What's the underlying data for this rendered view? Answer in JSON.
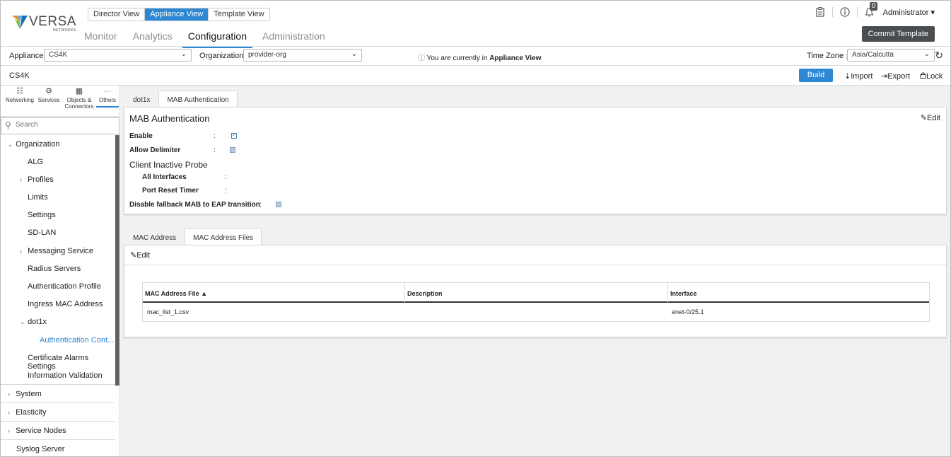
{
  "brand": {
    "name": "VERSA",
    "sub": "NETWORKS"
  },
  "views": [
    "Director View",
    "Appliance View",
    "Template View"
  ],
  "active_view": "Appliance View",
  "main_nav": [
    "Monitor",
    "Analytics",
    "Configuration",
    "Administration"
  ],
  "header": {
    "notifications": "0",
    "user": "Administrator ▾",
    "commit": "Commit Template"
  },
  "appliance_bar": {
    "appliance_label": "Appliance",
    "appliance_value": "CS4K",
    "org_label": "Organization",
    "org_value": "provider-org",
    "info_prefix": "You are currently in ",
    "info_view": "Appliance View",
    "tz_label": "Time Zone :",
    "tz_value": "Asia/Calcutta"
  },
  "breadcrumb": "CS4K",
  "actions": {
    "build": "Build",
    "import": "Import",
    "export": "Export",
    "lock": "Lock"
  },
  "sidebar": {
    "tabs": [
      "Networking",
      "Services",
      "Objects &",
      "Connectors",
      "Others"
    ],
    "search_placeholder": "Search",
    "tree": {
      "organization": "Organization",
      "alg": "ALG",
      "profiles": "Profiles",
      "limits": "Limits",
      "settings": "Settings",
      "sdlan": "SD-LAN",
      "messaging": "Messaging Service",
      "radius": "Radius Servers",
      "authprofile": "Authentication Profile",
      "ingress": "Ingress MAC Address",
      "dot1x": "dot1x",
      "authcont": "Authentication Cont...",
      "certalarms": "Certificate Alarms Settings",
      "infoval": "Information Validation",
      "system": "System",
      "elasticity": "Elasticity",
      "servicenodes": "Service Nodes",
      "syslog": "Syslog Server"
    }
  },
  "content": {
    "tabs": [
      "dot1x",
      "MAB Authentication"
    ],
    "mab": {
      "title": "MAB Authentication",
      "edit": "Edit",
      "enable": "Enable",
      "allow_delimiter": "Allow Delimiter",
      "client_probe": "Client Inactive Probe",
      "all_interfaces": "All Interfaces",
      "port_reset": "Port Reset Timer",
      "disable_fallback": "Disable fallback MAB to EAP transition",
      "colon": ":"
    },
    "mac_tabs": [
      "MAC Address",
      "MAC Address Files"
    ],
    "mac_edit": "Edit",
    "table": {
      "headers": [
        "MAC Address File",
        "Description",
        "Interface"
      ],
      "rows": [
        [
          "mac_list_1.csv",
          "",
          "enet-0/25.1"
        ]
      ]
    }
  }
}
